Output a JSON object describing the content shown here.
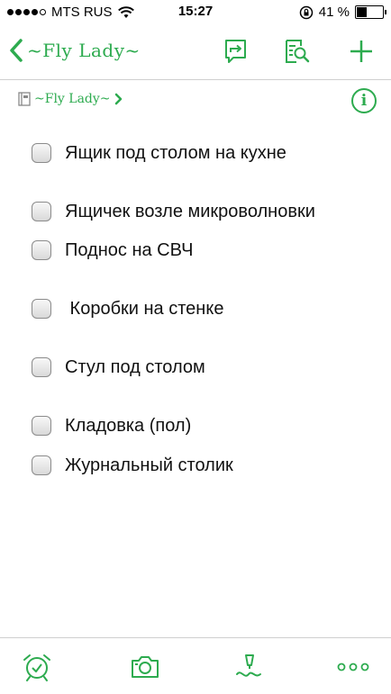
{
  "status_bar": {
    "carrier": "MTS RUS",
    "time": "15:27",
    "battery_percent": "41 %",
    "battery_level": 0.41,
    "signal_bars": 4
  },
  "nav": {
    "back_label": "~Fly Lady~",
    "icons": [
      "share-icon",
      "note-search-icon",
      "add-icon"
    ]
  },
  "notebook": {
    "label": "~Fly Lady~",
    "info_label": "i"
  },
  "checklist": [
    {
      "text": "Ящик под столом на кухне",
      "checked": false
    },
    {
      "text": "Ящичек возле микроволновки",
      "checked": false
    },
    {
      "text": "Поднос на СВЧ",
      "checked": false
    },
    {
      "text": " Коробки на стенке",
      "checked": false
    },
    {
      "text": "Стул под столом",
      "checked": false
    },
    {
      "text": "Кладовка (пол)",
      "checked": false
    },
    {
      "text": "Журнальный столик",
      "checked": false
    }
  ],
  "toolbar": {
    "icons": [
      "alarm-icon",
      "camera-icon",
      "handwriting-icon",
      "more-icon"
    ]
  },
  "colors": {
    "accent": "#2dab4f"
  }
}
